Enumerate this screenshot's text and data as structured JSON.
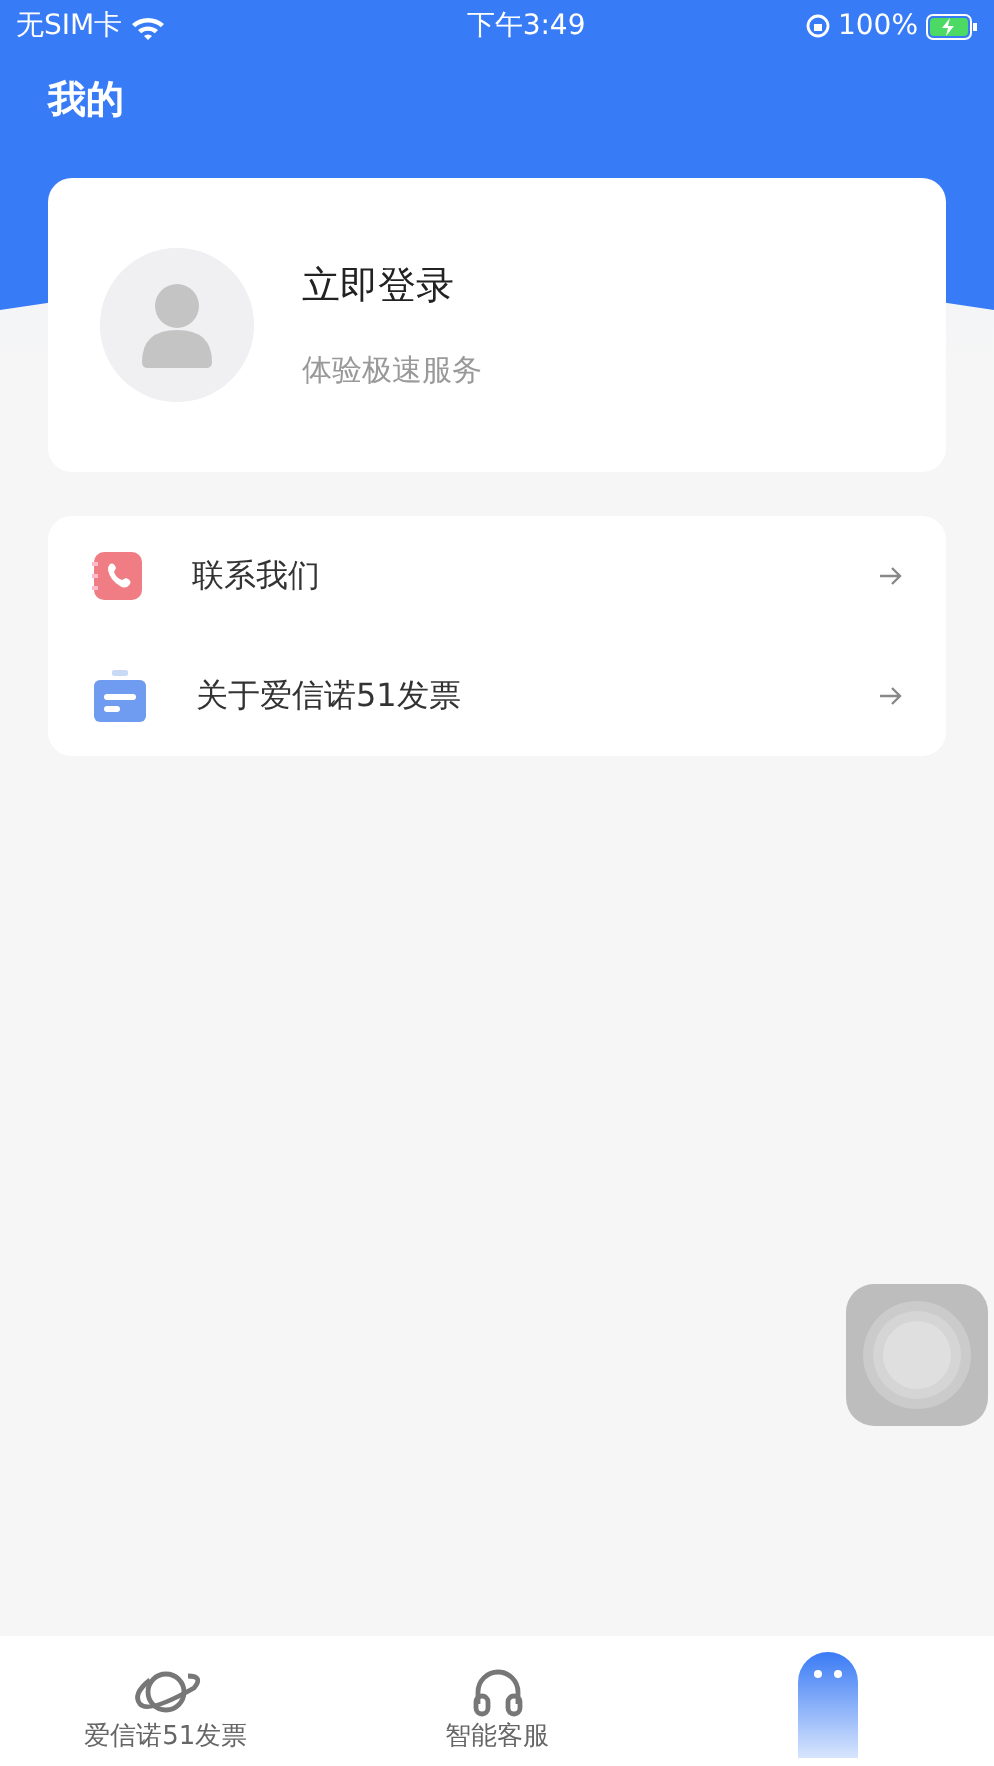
{
  "status_bar": {
    "carrier": "无SIM卡",
    "time": "下午3:49",
    "battery": "100%"
  },
  "header": {
    "title": "我的"
  },
  "profile": {
    "name": "立即登录",
    "subtitle": "体验极速服务"
  },
  "menu": [
    {
      "kind": "phone",
      "label": "联系我们"
    },
    {
      "kind": "about",
      "label": "关于爱信诺51发票"
    }
  ],
  "tab_bar": [
    {
      "kind": "planet",
      "label": "爱信诺51发票",
      "selected": false
    },
    {
      "kind": "headset",
      "label": "智能客服",
      "selected": false
    },
    {
      "kind": "mine",
      "selected": true
    }
  ]
}
